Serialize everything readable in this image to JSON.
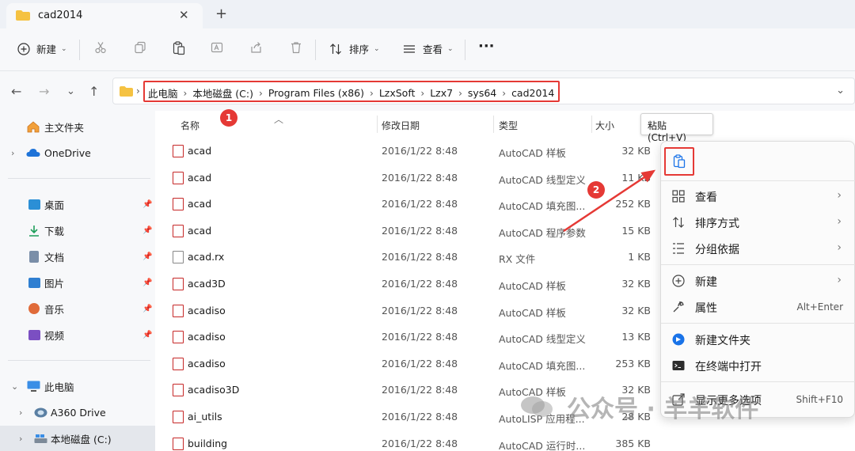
{
  "window": {
    "tab_title": "cad2014",
    "new_tab": "+",
    "close": "✕"
  },
  "toolbar": {
    "new_label": "新建",
    "sort_label": "排序",
    "view_label": "查看",
    "more_label": "···"
  },
  "address": {
    "crumbs": [
      "此电脑",
      "本地磁盘 (C:)",
      "Program Files (x86)",
      "LzxSoft",
      "Lzx7",
      "sys64",
      "cad2014"
    ]
  },
  "sidebar": {
    "home": "主文件夹",
    "onedrive": "OneDrive",
    "quick": [
      {
        "label": "桌面",
        "color": "#2b8fd6"
      },
      {
        "label": "下载",
        "color": "#1e9e5a"
      },
      {
        "label": "文档",
        "color": "#7a8ea8"
      },
      {
        "label": "图片",
        "color": "#2f7fd1"
      },
      {
        "label": "音乐",
        "color": "#e06b3a"
      },
      {
        "label": "视频",
        "color": "#7b4fc2"
      }
    ],
    "this_pc": "此电脑",
    "a360": "A360 Drive",
    "local_c": "本地磁盘 (C:)"
  },
  "columns": {
    "name": "名称",
    "modified": "修改日期",
    "type": "类型",
    "size": "大小"
  },
  "files": [
    {
      "name": "acad",
      "date": "2016/1/22 8:48",
      "type": "AutoCAD 样板",
      "size": "32 KB"
    },
    {
      "name": "acad",
      "date": "2016/1/22 8:48",
      "type": "AutoCAD 线型定义",
      "size": "11 KB"
    },
    {
      "name": "acad",
      "date": "2016/1/22 8:48",
      "type": "AutoCAD 填充图...",
      "size": "252 KB"
    },
    {
      "name": "acad",
      "date": "2016/1/22 8:48",
      "type": "AutoCAD 程序参数",
      "size": "15 KB"
    },
    {
      "name": "acad.rx",
      "date": "2016/1/22 8:48",
      "type": "RX 文件",
      "size": "1 KB"
    },
    {
      "name": "acad3D",
      "date": "2016/1/22 8:48",
      "type": "AutoCAD 样板",
      "size": "32 KB"
    },
    {
      "name": "acadiso",
      "date": "2016/1/22 8:48",
      "type": "AutoCAD 样板",
      "size": "32 KB"
    },
    {
      "name": "acadiso",
      "date": "2016/1/22 8:48",
      "type": "AutoCAD 线型定义",
      "size": "13 KB"
    },
    {
      "name": "acadiso",
      "date": "2016/1/22 8:48",
      "type": "AutoCAD 填充图...",
      "size": "253 KB"
    },
    {
      "name": "acadiso3D",
      "date": "2016/1/22 8:48",
      "type": "AutoCAD 样板",
      "size": "32 KB"
    },
    {
      "name": "ai_utils",
      "date": "2016/1/22 8:48",
      "type": "AutoLISP 应用程...",
      "size": "28 KB"
    },
    {
      "name": "building",
      "date": "2016/1/22 8:48",
      "type": "AutoCAD 运行时...",
      "size": "385 KB"
    }
  ],
  "context_menu": {
    "tooltip": "粘贴 (Ctrl+V)",
    "view": "查看",
    "sort": "排序方式",
    "group": "分组依据",
    "new": "新建",
    "properties": "属性",
    "properties_shortcut": "Alt+Enter",
    "new_folder": "新建文件夹",
    "terminal": "在终端中打开",
    "more": "显示更多选项",
    "more_shortcut": "Shift+F10"
  },
  "annotations": {
    "badge1": "1",
    "badge2": "2"
  },
  "watermark": {
    "text": "公众号 · 羊羊软件"
  },
  "colors": {
    "highlight": "#e53935",
    "accent": "#1a73e8",
    "pdf_red": "#c62828"
  }
}
